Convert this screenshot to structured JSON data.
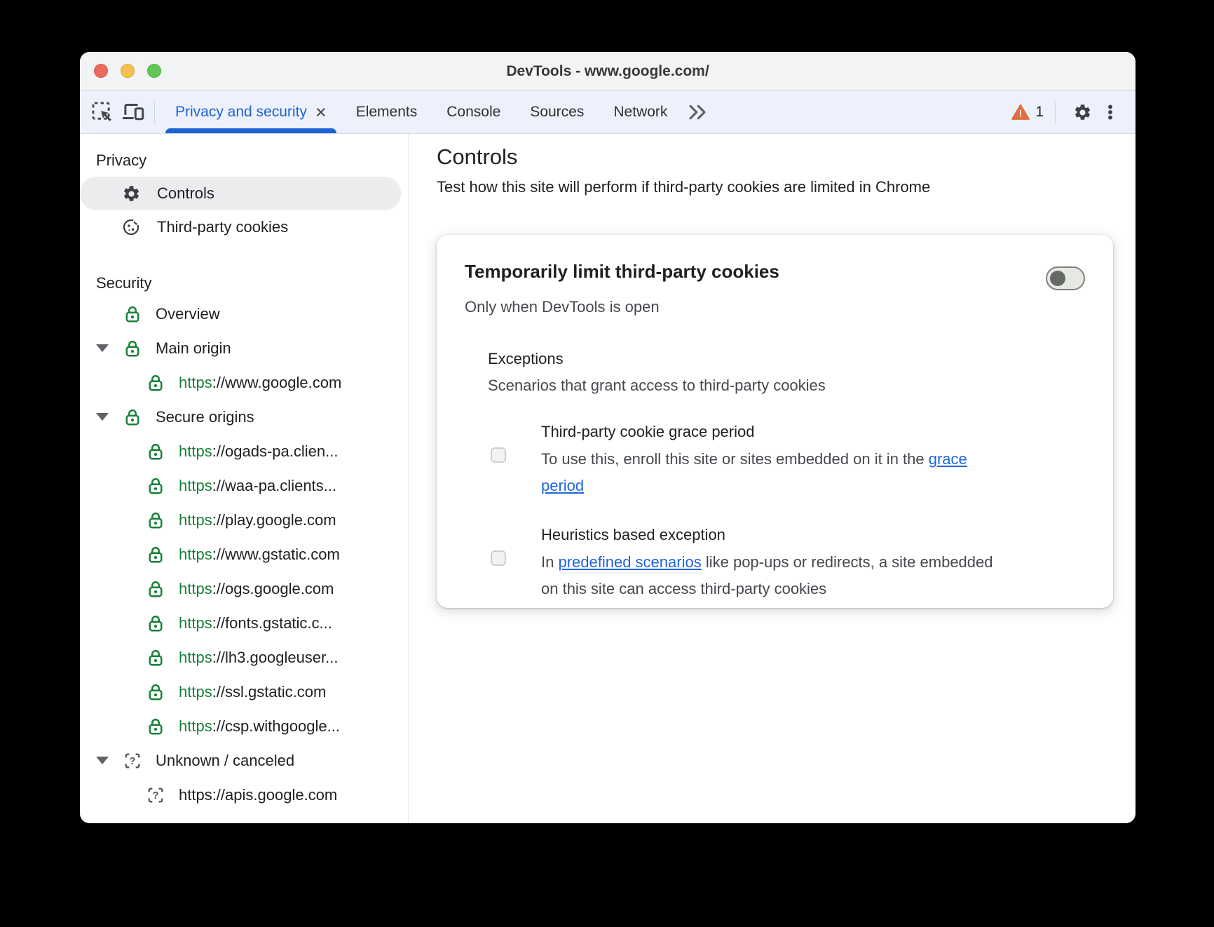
{
  "window": {
    "title": "DevTools - www.google.com/"
  },
  "toolbar": {
    "tabs": [
      {
        "label": "Privacy and security",
        "selected": true,
        "closable": true
      },
      {
        "label": "Elements",
        "selected": false,
        "closable": false
      },
      {
        "label": "Console",
        "selected": false,
        "closable": false
      },
      {
        "label": "Sources",
        "selected": false,
        "closable": false
      },
      {
        "label": "Network",
        "selected": false,
        "closable": false
      }
    ],
    "tab_close_glyph": "×",
    "warning_count": "1"
  },
  "sidebar": {
    "sections": [
      {
        "title": "Privacy",
        "items": [
          {
            "label": "Controls",
            "icon": "gear",
            "selected": true
          },
          {
            "label": "Third-party cookies",
            "icon": "cookie",
            "selected": false
          }
        ]
      },
      {
        "title": "Security",
        "tree": [
          {
            "level": 0,
            "icon": "lock",
            "expander": false,
            "parts": [
              {
                "text": "Overview"
              }
            ]
          },
          {
            "level": 0,
            "icon": "lock",
            "expander": true,
            "parts": [
              {
                "text": "Main origin"
              }
            ]
          },
          {
            "level": 1,
            "icon": "lock",
            "expander": false,
            "parts": [
              {
                "text": "https",
                "green": true
              },
              {
                "text": "://www.google.com"
              }
            ]
          },
          {
            "level": 0,
            "icon": "lock",
            "expander": true,
            "parts": [
              {
                "text": "Secure origins"
              }
            ]
          },
          {
            "level": 1,
            "icon": "lock",
            "expander": false,
            "parts": [
              {
                "text": "https",
                "green": true
              },
              {
                "text": "://ogads-pa.clien..."
              }
            ]
          },
          {
            "level": 1,
            "icon": "lock",
            "expander": false,
            "parts": [
              {
                "text": "https",
                "green": true
              },
              {
                "text": "://waa-pa.clients..."
              }
            ]
          },
          {
            "level": 1,
            "icon": "lock",
            "expander": false,
            "parts": [
              {
                "text": "https",
                "green": true
              },
              {
                "text": "://play.google.com"
              }
            ]
          },
          {
            "level": 1,
            "icon": "lock",
            "expander": false,
            "parts": [
              {
                "text": "https",
                "green": true
              },
              {
                "text": "://www.gstatic.com"
              }
            ]
          },
          {
            "level": 1,
            "icon": "lock",
            "expander": false,
            "parts": [
              {
                "text": "https",
                "green": true
              },
              {
                "text": "://ogs.google.com"
              }
            ]
          },
          {
            "level": 1,
            "icon": "lock",
            "expander": false,
            "parts": [
              {
                "text": "https",
                "green": true
              },
              {
                "text": "://fonts.gstatic.c..."
              }
            ]
          },
          {
            "level": 1,
            "icon": "lock",
            "expander": false,
            "parts": [
              {
                "text": "https",
                "green": true
              },
              {
                "text": "://lh3.googleuser..."
              }
            ]
          },
          {
            "level": 1,
            "icon": "lock",
            "expander": false,
            "parts": [
              {
                "text": "https",
                "green": true
              },
              {
                "text": "://ssl.gstatic.com"
              }
            ]
          },
          {
            "level": 1,
            "icon": "lock",
            "expander": false,
            "parts": [
              {
                "text": "https",
                "green": true
              },
              {
                "text": "://csp.withgoogle..."
              }
            ]
          },
          {
            "level": 0,
            "icon": "unknown",
            "expander": true,
            "parts": [
              {
                "text": "Unknown / canceled"
              }
            ]
          },
          {
            "level": 1,
            "icon": "unknown",
            "expander": false,
            "parts": [
              {
                "text": "https://apis.google.com"
              }
            ]
          }
        ]
      }
    ]
  },
  "main": {
    "title": "Controls",
    "subtitle": "Test how this site will perform if third-party cookies are limited in Chrome",
    "card": {
      "title": "Temporarily limit third-party cookies",
      "toggle_state": "off",
      "subtitle": "Only when DevTools is open",
      "exceptions": {
        "title": "Exceptions",
        "subtitle": "Scenarios that grant access to third-party cookies",
        "items": [
          {
            "label": "Third-party cookie grace period",
            "checked": false,
            "description_parts": [
              {
                "text": "To use this, enroll this site or sites embedded on it in the "
              },
              {
                "text": "grace period",
                "link": true
              }
            ]
          },
          {
            "label": "Heuristics based exception",
            "checked": false,
            "description_parts": [
              {
                "text": "In "
              },
              {
                "text": "predefined scenarios",
                "link": true
              },
              {
                "text": " like pop-ups or redirects, a site embedded on this site can access third-party cookies"
              }
            ]
          }
        ]
      }
    }
  },
  "colors": {
    "accent_blue": "#1e63d3",
    "link_blue": "#1f66dd",
    "secure_green": "#188038",
    "warning_orange": "#dd7141"
  }
}
